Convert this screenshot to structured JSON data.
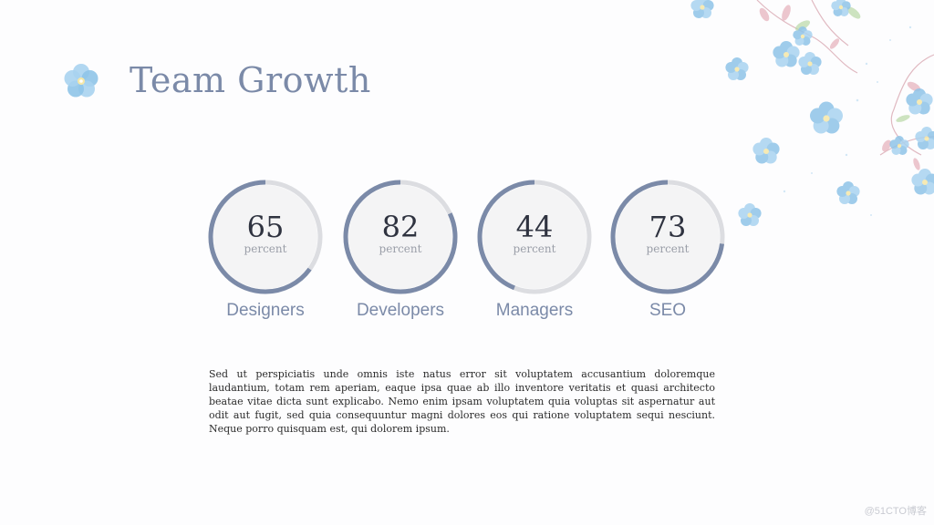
{
  "title": "Team Growth",
  "colors": {
    "accent": "#7b8aa8",
    "track": "#dcdde1",
    "inner": "#f4f4f5",
    "flower": "#8fc4e8"
  },
  "gauges": [
    {
      "value": "65",
      "percent": 65,
      "unit": "percent",
      "label": "Designers"
    },
    {
      "value": "82",
      "percent": 82,
      "unit": "percent",
      "label": "Developers"
    },
    {
      "value": "44",
      "percent": 44,
      "unit": "percent",
      "label": "Managers"
    },
    {
      "value": "73",
      "percent": 73,
      "unit": "percent",
      "label": "SEO"
    }
  ],
  "body_text": "Sed ut perspiciatis unde omnis iste natus error sit voluptatem accusantium doloremque laudantium, totam rem aperiam, eaque ipsa quae ab illo inventore veritatis et quasi architecto beatae vitae dicta sunt explicabo. Nemo enim ipsam voluptatem quia voluptas sit aspernatur aut odit aut fugit, sed quia consequuntur magni dolores eos qui ratione voluptatem sequi nesciunt. Neque porro quisquam est, qui dolorem ipsum.",
  "watermark": "@51CTO博客"
}
